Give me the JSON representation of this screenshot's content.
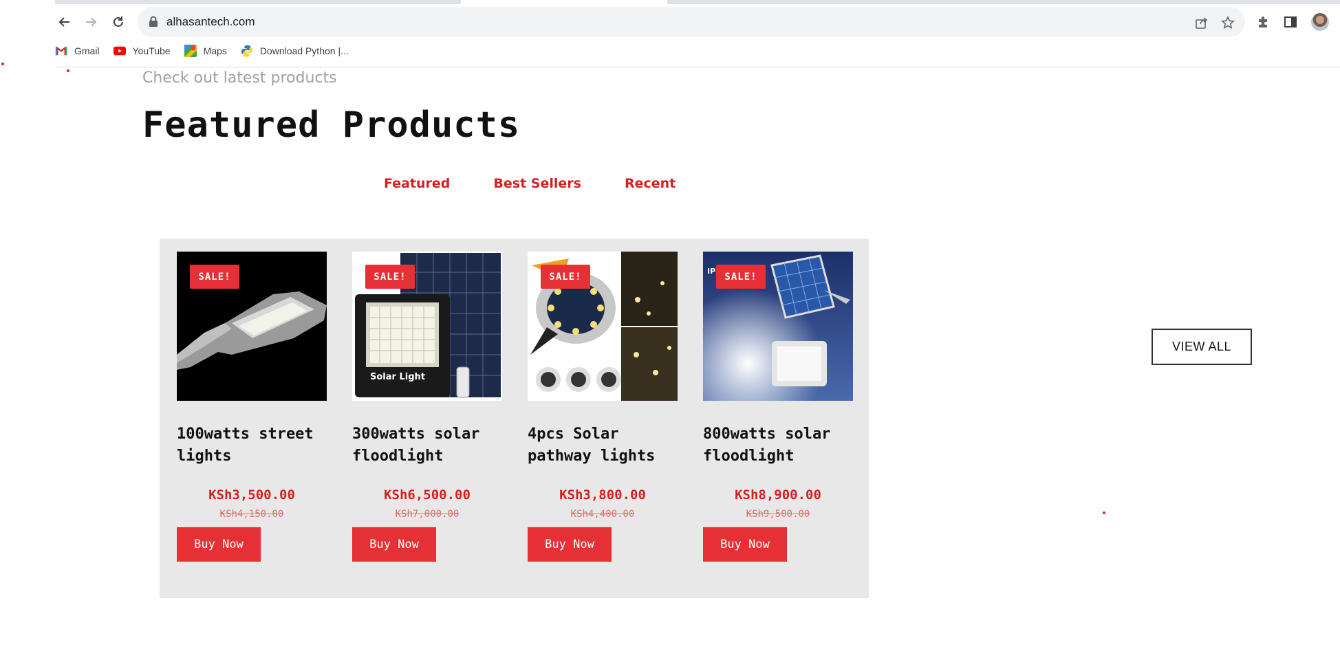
{
  "browser": {
    "url": "alhasantech.com",
    "bookmarks": [
      {
        "label": "Gmail",
        "icon": "gmail-icon"
      },
      {
        "label": "YouTube",
        "icon": "youtube-icon"
      },
      {
        "label": "Maps",
        "icon": "maps-icon"
      },
      {
        "label": "Download Python |...",
        "icon": "python-icon"
      }
    ]
  },
  "section": {
    "subtitle": "Check out latest products",
    "title": "Featured Products"
  },
  "filters": [
    {
      "label": "Featured"
    },
    {
      "label": "Best Sellers"
    },
    {
      "label": "Recent"
    }
  ],
  "products": [
    {
      "badge": "SALE!",
      "name": "100watts street lights",
      "price": "KSh3,500.00",
      "old_price": "KSh4,150.00",
      "buy_label": "Buy Now",
      "image": "street-light-image"
    },
    {
      "badge": "SALE!",
      "name": "300watts solar floodlight",
      "price": "KSh6,500.00",
      "old_price": "KSh7,000.00",
      "buy_label": "Buy Now",
      "image": "solar-floodlight-image",
      "image_text": "Solar Light"
    },
    {
      "badge": "SALE!",
      "name": "4pcs Solar pathway lights",
      "price": "KSh3,800.00",
      "old_price": "KSh4,400.00",
      "buy_label": "Buy Now",
      "image": "pathway-lights-image"
    },
    {
      "badge": "SALE!",
      "name": "800watts solar floodlight",
      "price": "KSh8,900.00",
      "old_price": "KSh9,500.00",
      "buy_label": "Buy Now",
      "image": "rain-floodlight-image",
      "image_text": "IP6   ROOF"
    }
  ],
  "view_all_label": "VIEW ALL",
  "colors": {
    "accent": "#e53036",
    "tab_text": "#d71f1f",
    "panel_bg": "#e8e8e8"
  }
}
